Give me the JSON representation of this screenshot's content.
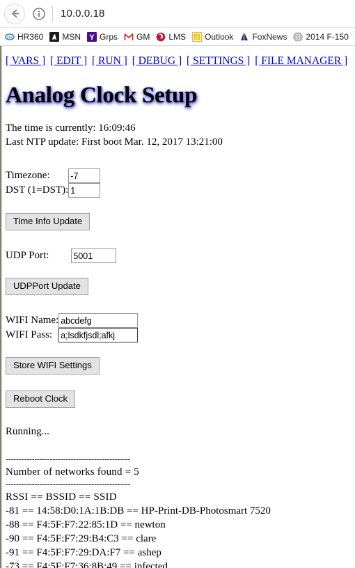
{
  "browser": {
    "back_label": "Back",
    "info_icon": "info-icon",
    "url": "10.0.0.18",
    "bookmarks": [
      {
        "label": "HR360",
        "icon": "hr360-favicon",
        "color": "#3f7fbf"
      },
      {
        "label": "MSN",
        "icon": "msn-favicon",
        "color": "#1b1b1b"
      },
      {
        "label": "Grps",
        "icon": "yahoo-favicon",
        "color": "#4a0d8f"
      },
      {
        "label": "GM",
        "icon": "gmail-favicon",
        "color": "#d93025"
      },
      {
        "label": "LMS",
        "icon": "lms-favicon",
        "color": "#c4122f"
      },
      {
        "label": "Outlook",
        "icon": "outlook-favicon",
        "color": "#f2b705"
      },
      {
        "label": "FoxNews",
        "icon": "foxnews-favicon",
        "color": "#1b2f6b"
      },
      {
        "label": "2014 F-150",
        "icon": "globe-favicon",
        "color": "#9a9a9a"
      }
    ]
  },
  "nav": {
    "links": [
      "[ VARS ]",
      "[ EDIT ]",
      "[ RUN ]",
      "[ DEBUG ]",
      "[ SETTINGS ]",
      "[ FILE MANAGER ]"
    ],
    "link_color": "#0000cc"
  },
  "page": {
    "title": "Analog Clock Setup",
    "time_line": "The time is currently: 16:09:46",
    "ntp_line": "Last NTP update: First boot Mar. 12, 2017 13:21:00",
    "status": "Running...",
    "separator": "------------------------------------------------",
    "networks_count_line": "Number of networks found = 5",
    "networks_header": "RSSI == BSSID == SSID",
    "networks": [
      "-81 == 14:58:D0:1A:1B:DB == HP-Print-DB-Photosmart 7520",
      "-88 == F4:5F:F7:22:85:1D == newton",
      "-90 == F4:5F:F7:29:B4:C3 == clare",
      "-91 == F4:5F:F7:29:DA:F7 == ashep",
      "-73 == F4:5F:F7:36:8B:49 == infected"
    ]
  },
  "form": {
    "timezone_label": "Timezone:",
    "timezone_value": "-7",
    "dst_label": "DST (1=DST):",
    "dst_value": "1",
    "time_info_button": "Time Info Update",
    "udp_label": "UDP Port:",
    "udp_value": "5001",
    "udp_button": "UDPPort Update",
    "wifi_name_label": "WIFI Name:",
    "wifi_name_value": "abcdefg",
    "wifi_pass_label": "WIFI Pass:",
    "wifi_pass_value": "a;lsdkfjsdl;afkj",
    "store_wifi_button": "Store WIFI Settings",
    "reboot_button": "Reboot Clock"
  }
}
